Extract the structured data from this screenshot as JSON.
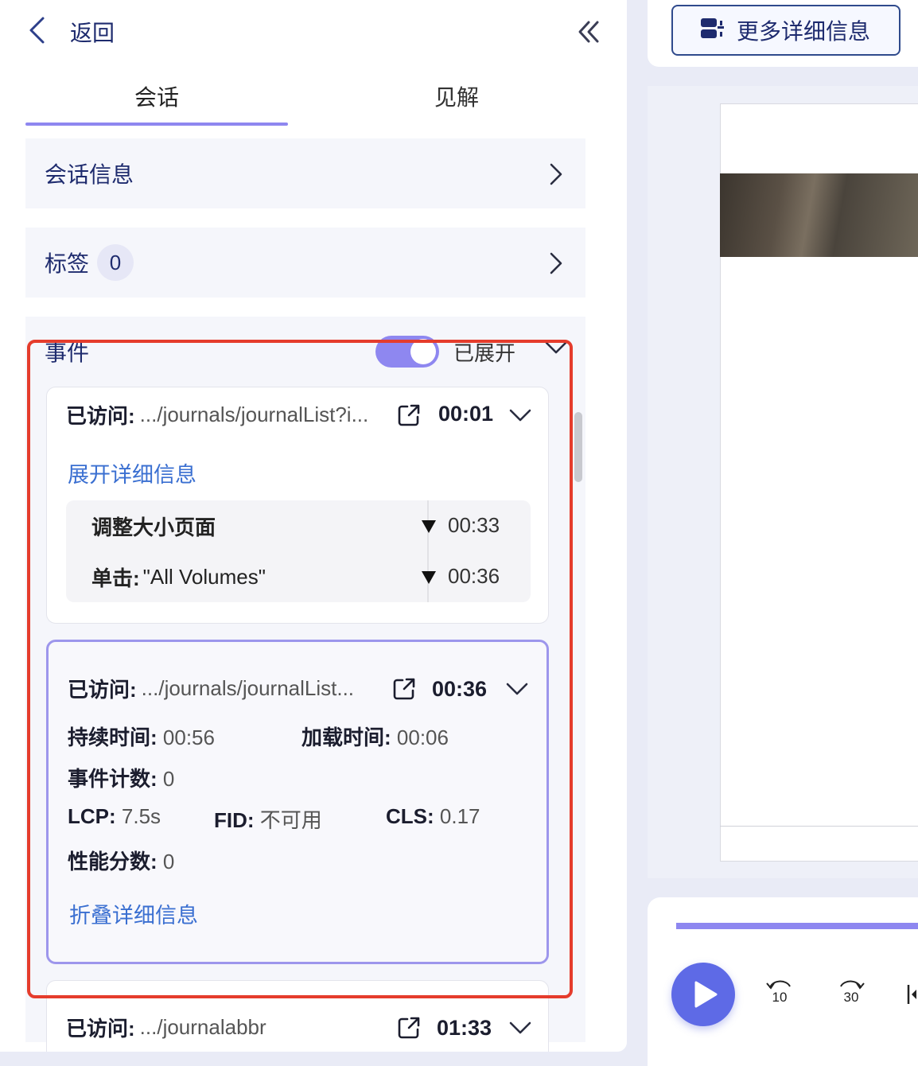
{
  "topbar": {
    "back_label": "返回"
  },
  "tabs": [
    {
      "label": "会话"
    },
    {
      "label": "见解"
    }
  ],
  "sections": {
    "session_info": {
      "title": "会话信息"
    },
    "tags": {
      "title": "标签",
      "count": "0"
    }
  },
  "events": {
    "title": "事件",
    "toggle_label": "已展开",
    "toggle_on": true,
    "cards": [
      {
        "visit_key": "已访问:",
        "visit_value": ".../journals/journalList?i...",
        "time": "00:01",
        "link": "展开详细信息",
        "sub_events": [
          {
            "key": "调整大小页面",
            "value": "",
            "time": "00:33"
          },
          {
            "key": "单击:",
            "value": "\"All Volumes\"",
            "time": "00:36"
          }
        ]
      },
      {
        "visit_key": "已访问:",
        "visit_value": ".../journals/journalList...",
        "time": "00:36",
        "details": {
          "duration_key": "持续时间:",
          "duration_value": "00:56",
          "load_key": "加载时间:",
          "load_value": "00:06",
          "event_count_key": "事件计数:",
          "event_count_value": "0",
          "lcp_key": "LCP:",
          "lcp_value": "7.5s",
          "fid_key": "FID:",
          "fid_value": "不可用",
          "cls_key": "CLS:",
          "cls_value": "0.17",
          "perf_key": "性能分数:",
          "perf_value": "0"
        },
        "link": "折叠详细信息"
      },
      {
        "visit_key": "已访问:",
        "visit_value": ".../journalabbr",
        "time": "01:33"
      }
    ]
  },
  "right": {
    "more_details_label": "更多详细信息",
    "skip_back": "10",
    "skip_forward": "30"
  },
  "colors": {
    "accent": "#8e87f0",
    "link": "#3a6fd1",
    "highlight": "#e53c2c",
    "play": "#5e6ae6",
    "heading": "#1e2b6e"
  }
}
